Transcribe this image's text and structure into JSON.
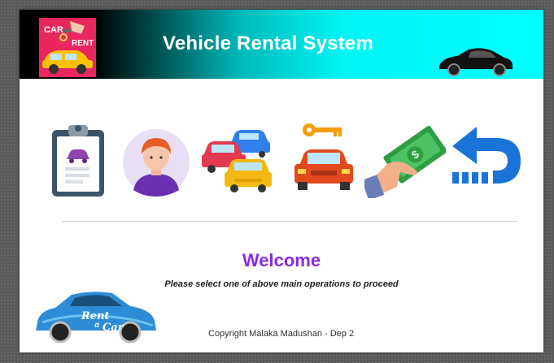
{
  "header": {
    "title": "Vehicle Rental System",
    "logo": {
      "top": "CAR",
      "bottom": "RENT"
    }
  },
  "toolbar": [
    {
      "name": "clipboard-car-icon",
      "label": "Reservations"
    },
    {
      "name": "customer-avatar-icon",
      "label": "Customers"
    },
    {
      "name": "vehicles-fleet-icon",
      "label": "Vehicles"
    },
    {
      "name": "car-key-icon",
      "label": "Rent"
    },
    {
      "name": "payment-cash-icon",
      "label": "Payment"
    },
    {
      "name": "return-arrow-icon",
      "label": "Return"
    }
  ],
  "main": {
    "welcome": "Welcome",
    "instruction": "Please select one of above main operations to proceed"
  },
  "footer": {
    "copyright": "Copyright Malaka Madushan  - Dep 2",
    "rent_car_text_1": "Rent",
    "rent_car_text_2": "a",
    "rent_car_text_3": "Car"
  },
  "colors": {
    "header_gradient_start": "#000000",
    "header_gradient_end": "#00ffff",
    "welcome": "#8a2be2"
  }
}
